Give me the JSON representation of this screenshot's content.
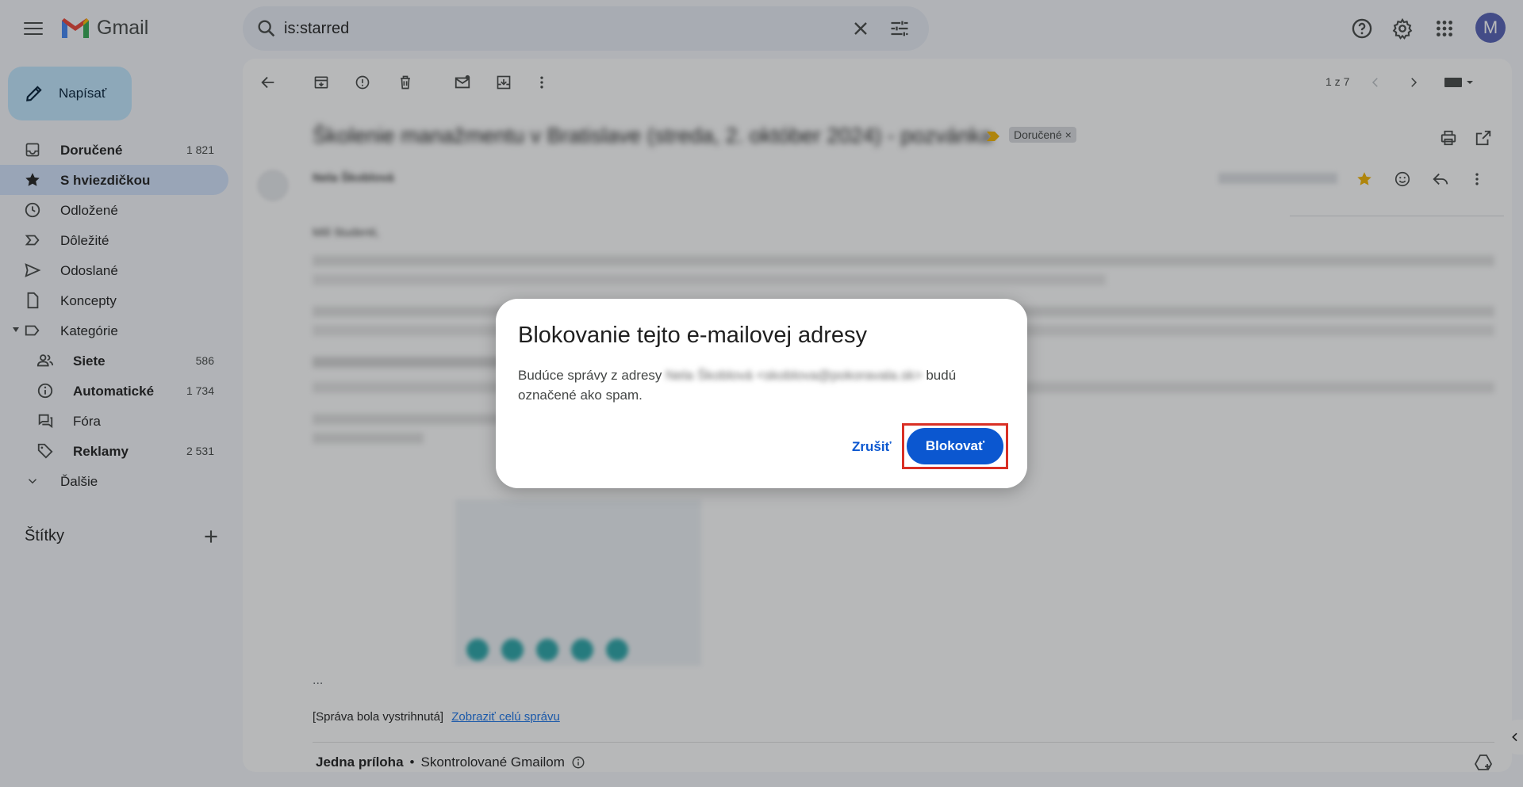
{
  "app": {
    "name": "Gmail"
  },
  "search": {
    "value": "is:starred"
  },
  "compose": {
    "label": "Napísať"
  },
  "nav": [
    {
      "label": "Doručené",
      "count": "1 821",
      "icon": "inbox-icon",
      "bold": true
    },
    {
      "label": "S hviezdičkou",
      "count": "",
      "icon": "star-icon",
      "active": true
    },
    {
      "label": "Odložené",
      "count": "",
      "icon": "clock-icon"
    },
    {
      "label": "Dôležité",
      "count": "",
      "icon": "important-icon"
    },
    {
      "label": "Odoslané",
      "count": "",
      "icon": "send-icon"
    },
    {
      "label": "Koncepty",
      "count": "",
      "icon": "draft-icon"
    },
    {
      "label": "Kategórie",
      "count": "",
      "icon": "label-icon"
    },
    {
      "label": "Siete",
      "count": "586",
      "icon": "people-icon",
      "sub": true,
      "bold": true
    },
    {
      "label": "Automatické",
      "count": "1 734",
      "icon": "info-icon",
      "sub": true,
      "bold": true
    },
    {
      "label": "Fóra",
      "count": "",
      "icon": "forum-icon",
      "sub": true
    },
    {
      "label": "Reklamy",
      "count": "2 531",
      "icon": "tag-icon",
      "sub": true,
      "bold": true
    },
    {
      "label": "Ďalšie",
      "count": "",
      "icon": "chevron-down-icon"
    }
  ],
  "labels": {
    "heading": "Štítky"
  },
  "toolbar": {
    "pager": "1 z 7"
  },
  "email": {
    "subject": "Školenie manažmentu v Bratislave (streda, 2. október 2024) - pozvánka",
    "label_chip": "Doručené",
    "sender": "Nela Škoblová",
    "greeting": "Milí študenti,",
    "ellipsis": "...",
    "trimmed_note": "[Správa bola vystrihnutá]",
    "show_full": "Zobraziť celú správu",
    "attachment_title": "Jedna príloha",
    "attachment_checked": "Skontrolované Gmailom"
  },
  "dialog": {
    "title": "Blokovanie tejto e-mailovej adresy",
    "text_before": "Budúce správy z adresy",
    "text_after": "budú označené ako spam.",
    "blurred_email": "Nela Škoblová <skoblova@pokoravala.sk>",
    "cancel": "Zrušiť",
    "confirm": "Blokovať"
  },
  "colors": {
    "accent": "#0b57d0",
    "highlight": "#d93025",
    "active_nav": "#d3e3fd"
  }
}
